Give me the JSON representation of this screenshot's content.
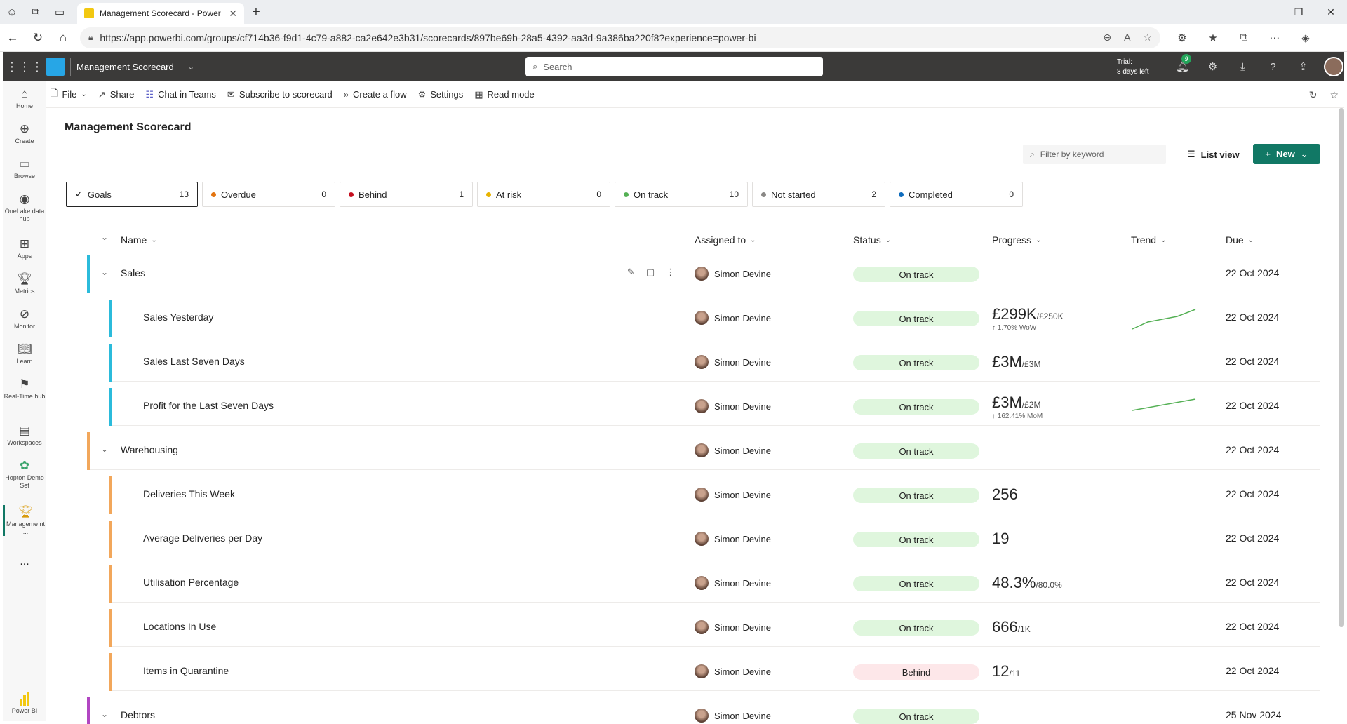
{
  "browser": {
    "tab_title": "Management Scorecard - Power BI",
    "url": "https://app.powerbi.com/groups/cf714b36-f9d1-4c79-a882-ca2e642e3b31/scorecards/897be69b-28a5-4392-aa3d-9a386ba220f8?experience=power-bi"
  },
  "header": {
    "app_name": "Management Scorecard",
    "search_placeholder": "Search",
    "trial_line1": "Trial:",
    "trial_line2": "8 days left",
    "notification_count": "9"
  },
  "leftnav": [
    {
      "label": "Home",
      "icon": "home-icon"
    },
    {
      "label": "Create",
      "icon": "create-icon"
    },
    {
      "label": "Browse",
      "icon": "folder-icon"
    },
    {
      "label": "OneLake data hub",
      "icon": "onelake-icon"
    },
    {
      "label": "Apps",
      "icon": "apps-icon"
    },
    {
      "label": "Metrics",
      "icon": "trophy-icon"
    },
    {
      "label": "Monitor",
      "icon": "monitor-icon"
    },
    {
      "label": "Learn",
      "icon": "book-icon"
    },
    {
      "label": "Real-Time hub",
      "icon": "realtime-icon"
    },
    {
      "label": "Workspaces",
      "icon": "workspaces-icon"
    },
    {
      "label": "Hopton Demo Set",
      "icon": "workspace-icon"
    },
    {
      "label": "Manageme nt ...",
      "icon": "scorecard-icon"
    }
  ],
  "leftnav_more": "...",
  "leftnav_footer": "Power BI",
  "commands": [
    {
      "label": "File",
      "icon": "file-icon"
    },
    {
      "label": "Share",
      "icon": "share-icon"
    },
    {
      "label": "Chat in Teams",
      "icon": "teams-icon"
    },
    {
      "label": "Subscribe to scorecard",
      "icon": "subscribe-icon"
    },
    {
      "label": "Create a flow",
      "icon": "flow-icon"
    },
    {
      "label": "Settings",
      "icon": "gear-icon"
    },
    {
      "label": "Read mode",
      "icon": "read-mode-icon"
    }
  ],
  "page": {
    "title": "Management Scorecard",
    "filter_placeholder": "Filter by keyword",
    "list_view": "List view",
    "new_button": "New"
  },
  "status_cards": [
    {
      "label": "Goals",
      "count": "13",
      "color": ""
    },
    {
      "label": "Overdue",
      "count": "0",
      "color": "#e3740f"
    },
    {
      "label": "Behind",
      "count": "1",
      "color": "#c50f1f"
    },
    {
      "label": "At risk",
      "count": "0",
      "color": "#e8b300"
    },
    {
      "label": "On track",
      "count": "10",
      "color": "#54b054"
    },
    {
      "label": "Not started",
      "count": "2",
      "color": "#8a8886"
    },
    {
      "label": "Completed",
      "count": "0",
      "color": "#0f6cbd"
    }
  ],
  "columns": {
    "name": "Name",
    "assigned": "Assigned to",
    "status": "Status",
    "progress": "Progress",
    "trend": "Trend",
    "due": "Due"
  },
  "rows": [
    {
      "name": "Sales",
      "level": 0,
      "color": "#2bbbdb",
      "assignee": "Simon Devine",
      "status": "On track",
      "value": "",
      "target": "",
      "sub": "",
      "trend": false,
      "due": "22 Oct 2024"
    },
    {
      "name": "Sales Yesterday",
      "level": 1,
      "color": "#2bbbdb",
      "assignee": "Simon Devine",
      "status": "On track",
      "value": "£299K",
      "target": "/£250K",
      "sub": "↑ 1.70% WoW",
      "trend": true,
      "due": "22 Oct 2024"
    },
    {
      "name": "Sales Last Seven Days",
      "level": 1,
      "color": "#2bbbdb",
      "assignee": "Simon Devine",
      "status": "On track",
      "value": "£3M",
      "target": "/£3M",
      "sub": "",
      "trend": false,
      "due": "22 Oct 2024"
    },
    {
      "name": "Profit for the Last Seven Days",
      "level": 1,
      "color": "#2bbbdb",
      "assignee": "Simon Devine",
      "status": "On track",
      "value": "£3M",
      "target": "/£2M",
      "sub": "↑ 162.41% MoM",
      "trend": true,
      "due": "22 Oct 2024"
    },
    {
      "name": "Warehousing",
      "level": 0,
      "color": "#f2a75b",
      "assignee": "Simon Devine",
      "status": "On track",
      "value": "",
      "target": "",
      "sub": "",
      "trend": false,
      "due": "22 Oct 2024"
    },
    {
      "name": "Deliveries This Week",
      "level": 1,
      "color": "#f2a75b",
      "assignee": "Simon Devine",
      "status": "On track",
      "value": "256",
      "target": "",
      "sub": "",
      "trend": false,
      "due": "22 Oct 2024"
    },
    {
      "name": "Average Deliveries per Day",
      "level": 1,
      "color": "#f2a75b",
      "assignee": "Simon Devine",
      "status": "On track",
      "value": "19",
      "target": "",
      "sub": "",
      "trend": false,
      "due": "22 Oct 2024"
    },
    {
      "name": "Utilisation Percentage",
      "level": 1,
      "color": "#f2a75b",
      "assignee": "Simon Devine",
      "status": "On track",
      "value": "48.3%",
      "target": "/80.0%",
      "sub": "",
      "trend": false,
      "due": "22 Oct 2024"
    },
    {
      "name": "Locations In Use",
      "level": 1,
      "color": "#f2a75b",
      "assignee": "Simon Devine",
      "status": "On track",
      "value": "666",
      "target": "/1K",
      "sub": "",
      "trend": false,
      "due": "22 Oct 2024"
    },
    {
      "name": "Items in Quarantine",
      "level": 1,
      "color": "#f2a75b",
      "assignee": "Simon Devine",
      "status": "Behind",
      "value": "12",
      "target": "/11",
      "sub": "",
      "trend": false,
      "due": "22 Oct 2024"
    },
    {
      "name": "Debtors",
      "level": 0,
      "color": "#b146c2",
      "assignee": "Simon Devine",
      "status": "On track",
      "value": "",
      "target": "",
      "sub": "",
      "trend": false,
      "due": "25 Nov 2024"
    }
  ]
}
